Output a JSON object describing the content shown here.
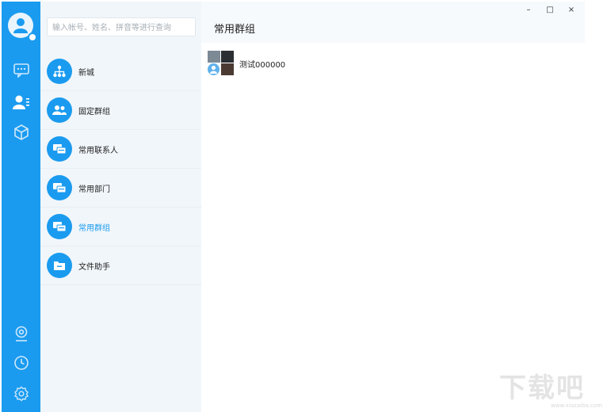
{
  "sidebar": {
    "nav": [
      {
        "name": "messages",
        "icon": "chat-icon"
      },
      {
        "name": "contacts",
        "icon": "contacts-icon"
      },
      {
        "name": "apps",
        "icon": "cube-icon"
      }
    ],
    "bottom": [
      {
        "name": "location",
        "icon": "location-icon"
      },
      {
        "name": "history",
        "icon": "clock-icon"
      },
      {
        "name": "settings",
        "icon": "gear-icon"
      }
    ],
    "accent_color": "#1a9bf0"
  },
  "search": {
    "placeholder": "输入帐号、姓名、拼音等进行查询"
  },
  "menu": {
    "items": [
      {
        "label": "新城",
        "icon": "org-chart-icon",
        "active": false
      },
      {
        "label": "固定群组",
        "icon": "group-icon",
        "active": false
      },
      {
        "label": "常用联系人",
        "icon": "contacts-card-icon",
        "active": false
      },
      {
        "label": "常用部门",
        "icon": "department-icon",
        "active": false
      },
      {
        "label": "常用群组",
        "icon": "group-chat-icon",
        "active": true
      },
      {
        "label": "文件助手",
        "icon": "folder-icon",
        "active": false
      }
    ]
  },
  "main": {
    "title": "常用群组",
    "groups": [
      {
        "name": "测试000000"
      }
    ]
  },
  "window_controls": {
    "minimize": "–",
    "maximize": "□",
    "close": "×"
  },
  "watermark": {
    "text": "下载吧",
    "url": "www.xiazaiba.com"
  }
}
